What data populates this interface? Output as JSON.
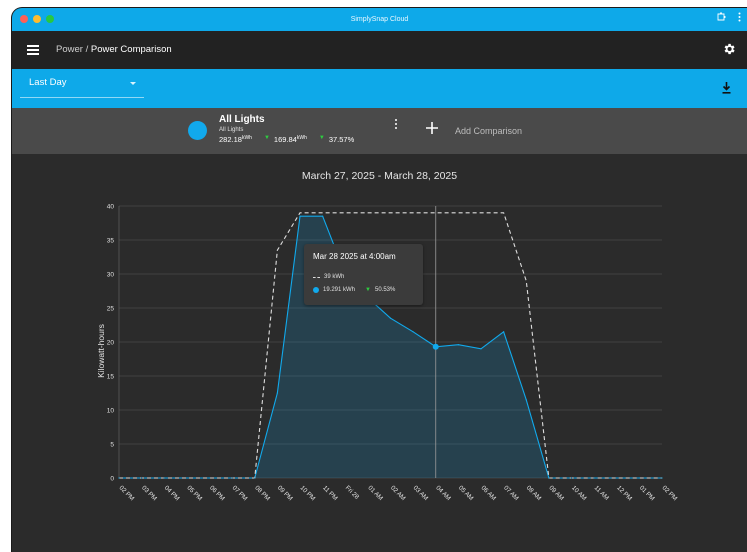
{
  "window": {
    "title": "SimplySnap Cloud"
  },
  "header": {
    "breadcrumb_parent": "Power",
    "breadcrumb_separator": "/",
    "breadcrumb_current": "Power Comparison"
  },
  "filter": {
    "range_value": "Last Day"
  },
  "comparison": {
    "name": "All Lights",
    "subtitle": "All Lights",
    "value_1": "282.18",
    "value_1_unit": "kWh",
    "value_2": "169.84",
    "value_2_unit": "kWh",
    "percent": "37.57%",
    "add_label": "Add Comparison"
  },
  "tooltip": {
    "title": "Mar 28 2025 at 4:00am",
    "row1_value": "39 kWh",
    "row2_value": "19.291 kWh",
    "row2_percent": "50.53%"
  },
  "colors": {
    "accent": "#0ea9e9",
    "series": "#11a9ec",
    "baseline": "#dddddd",
    "positive": "#2ecc40"
  },
  "chart_data": {
    "type": "area",
    "title": "March 27, 2025 - March 28, 2025",
    "xlabel": "",
    "ylabel": "Kilowatt-hours",
    "ylim": [
      0,
      40
    ],
    "yticks": [
      0,
      5,
      10,
      15,
      20,
      25,
      30,
      35,
      40
    ],
    "categories": [
      "02 PM",
      "03 PM",
      "04 PM",
      "05 PM",
      "06 PM",
      "07 PM",
      "08 PM",
      "09 PM",
      "10 PM",
      "11 PM",
      "Fri 28",
      "01 AM",
      "02 AM",
      "03 AM",
      "04 AM",
      "05 AM",
      "06 AM",
      "07 AM",
      "08 AM",
      "09 AM",
      "10 AM",
      "11 AM",
      "12 PM",
      "01 PM",
      "02 PM"
    ],
    "grid": true,
    "series": [
      {
        "style": "dashed",
        "values": [
          0,
          0,
          0,
          0,
          0,
          0,
          0,
          33.5,
          39,
          39,
          39,
          39,
          39,
          39,
          39,
          39,
          39,
          39,
          29,
          0,
          0,
          0,
          0,
          0,
          0
        ]
      },
      {
        "style": "area",
        "values": [
          0,
          0,
          0,
          0,
          0,
          0,
          0,
          12.5,
          38.5,
          38.5,
          30,
          26.5,
          23.5,
          21.5,
          19.3,
          19.6,
          19,
          21.5,
          11.5,
          0,
          0,
          0,
          0,
          0,
          0
        ]
      }
    ],
    "highlight_index": 14
  }
}
